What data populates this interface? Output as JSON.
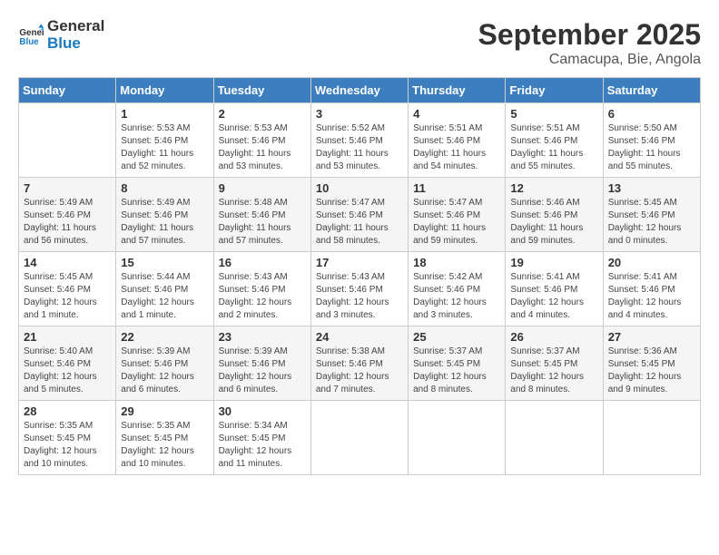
{
  "header": {
    "logo": {
      "line1": "General",
      "line2": "Blue"
    },
    "month": "September 2025",
    "location": "Camacupa, Bie, Angola"
  },
  "weekdays": [
    "Sunday",
    "Monday",
    "Tuesday",
    "Wednesday",
    "Thursday",
    "Friday",
    "Saturday"
  ],
  "weeks": [
    [
      {
        "day": "",
        "sunrise": "",
        "sunset": "",
        "daylight": ""
      },
      {
        "day": "1",
        "sunrise": "Sunrise: 5:53 AM",
        "sunset": "Sunset: 5:46 PM",
        "daylight": "Daylight: 11 hours and 52 minutes."
      },
      {
        "day": "2",
        "sunrise": "Sunrise: 5:53 AM",
        "sunset": "Sunset: 5:46 PM",
        "daylight": "Daylight: 11 hours and 53 minutes."
      },
      {
        "day": "3",
        "sunrise": "Sunrise: 5:52 AM",
        "sunset": "Sunset: 5:46 PM",
        "daylight": "Daylight: 11 hours and 53 minutes."
      },
      {
        "day": "4",
        "sunrise": "Sunrise: 5:51 AM",
        "sunset": "Sunset: 5:46 PM",
        "daylight": "Daylight: 11 hours and 54 minutes."
      },
      {
        "day": "5",
        "sunrise": "Sunrise: 5:51 AM",
        "sunset": "Sunset: 5:46 PM",
        "daylight": "Daylight: 11 hours and 55 minutes."
      },
      {
        "day": "6",
        "sunrise": "Sunrise: 5:50 AM",
        "sunset": "Sunset: 5:46 PM",
        "daylight": "Daylight: 11 hours and 55 minutes."
      }
    ],
    [
      {
        "day": "7",
        "sunrise": "Sunrise: 5:49 AM",
        "sunset": "Sunset: 5:46 PM",
        "daylight": "Daylight: 11 hours and 56 minutes."
      },
      {
        "day": "8",
        "sunrise": "Sunrise: 5:49 AM",
        "sunset": "Sunset: 5:46 PM",
        "daylight": "Daylight: 11 hours and 57 minutes."
      },
      {
        "day": "9",
        "sunrise": "Sunrise: 5:48 AM",
        "sunset": "Sunset: 5:46 PM",
        "daylight": "Daylight: 11 hours and 57 minutes."
      },
      {
        "day": "10",
        "sunrise": "Sunrise: 5:47 AM",
        "sunset": "Sunset: 5:46 PM",
        "daylight": "Daylight: 11 hours and 58 minutes."
      },
      {
        "day": "11",
        "sunrise": "Sunrise: 5:47 AM",
        "sunset": "Sunset: 5:46 PM",
        "daylight": "Daylight: 11 hours and 59 minutes."
      },
      {
        "day": "12",
        "sunrise": "Sunrise: 5:46 AM",
        "sunset": "Sunset: 5:46 PM",
        "daylight": "Daylight: 11 hours and 59 minutes."
      },
      {
        "day": "13",
        "sunrise": "Sunrise: 5:45 AM",
        "sunset": "Sunset: 5:46 PM",
        "daylight": "Daylight: 12 hours and 0 minutes."
      }
    ],
    [
      {
        "day": "14",
        "sunrise": "Sunrise: 5:45 AM",
        "sunset": "Sunset: 5:46 PM",
        "daylight": "Daylight: 12 hours and 1 minute."
      },
      {
        "day": "15",
        "sunrise": "Sunrise: 5:44 AM",
        "sunset": "Sunset: 5:46 PM",
        "daylight": "Daylight: 12 hours and 1 minute."
      },
      {
        "day": "16",
        "sunrise": "Sunrise: 5:43 AM",
        "sunset": "Sunset: 5:46 PM",
        "daylight": "Daylight: 12 hours and 2 minutes."
      },
      {
        "day": "17",
        "sunrise": "Sunrise: 5:43 AM",
        "sunset": "Sunset: 5:46 PM",
        "daylight": "Daylight: 12 hours and 3 minutes."
      },
      {
        "day": "18",
        "sunrise": "Sunrise: 5:42 AM",
        "sunset": "Sunset: 5:46 PM",
        "daylight": "Daylight: 12 hours and 3 minutes."
      },
      {
        "day": "19",
        "sunrise": "Sunrise: 5:41 AM",
        "sunset": "Sunset: 5:46 PM",
        "daylight": "Daylight: 12 hours and 4 minutes."
      },
      {
        "day": "20",
        "sunrise": "Sunrise: 5:41 AM",
        "sunset": "Sunset: 5:46 PM",
        "daylight": "Daylight: 12 hours and 4 minutes."
      }
    ],
    [
      {
        "day": "21",
        "sunrise": "Sunrise: 5:40 AM",
        "sunset": "Sunset: 5:46 PM",
        "daylight": "Daylight: 12 hours and 5 minutes."
      },
      {
        "day": "22",
        "sunrise": "Sunrise: 5:39 AM",
        "sunset": "Sunset: 5:46 PM",
        "daylight": "Daylight: 12 hours and 6 minutes."
      },
      {
        "day": "23",
        "sunrise": "Sunrise: 5:39 AM",
        "sunset": "Sunset: 5:46 PM",
        "daylight": "Daylight: 12 hours and 6 minutes."
      },
      {
        "day": "24",
        "sunrise": "Sunrise: 5:38 AM",
        "sunset": "Sunset: 5:46 PM",
        "daylight": "Daylight: 12 hours and 7 minutes."
      },
      {
        "day": "25",
        "sunrise": "Sunrise: 5:37 AM",
        "sunset": "Sunset: 5:45 PM",
        "daylight": "Daylight: 12 hours and 8 minutes."
      },
      {
        "day": "26",
        "sunrise": "Sunrise: 5:37 AM",
        "sunset": "Sunset: 5:45 PM",
        "daylight": "Daylight: 12 hours and 8 minutes."
      },
      {
        "day": "27",
        "sunrise": "Sunrise: 5:36 AM",
        "sunset": "Sunset: 5:45 PM",
        "daylight": "Daylight: 12 hours and 9 minutes."
      }
    ],
    [
      {
        "day": "28",
        "sunrise": "Sunrise: 5:35 AM",
        "sunset": "Sunset: 5:45 PM",
        "daylight": "Daylight: 12 hours and 10 minutes."
      },
      {
        "day": "29",
        "sunrise": "Sunrise: 5:35 AM",
        "sunset": "Sunset: 5:45 PM",
        "daylight": "Daylight: 12 hours and 10 minutes."
      },
      {
        "day": "30",
        "sunrise": "Sunrise: 5:34 AM",
        "sunset": "Sunset: 5:45 PM",
        "daylight": "Daylight: 12 hours and 11 minutes."
      },
      {
        "day": "",
        "sunrise": "",
        "sunset": "",
        "daylight": ""
      },
      {
        "day": "",
        "sunrise": "",
        "sunset": "",
        "daylight": ""
      },
      {
        "day": "",
        "sunrise": "",
        "sunset": "",
        "daylight": ""
      },
      {
        "day": "",
        "sunrise": "",
        "sunset": "",
        "daylight": ""
      }
    ]
  ]
}
